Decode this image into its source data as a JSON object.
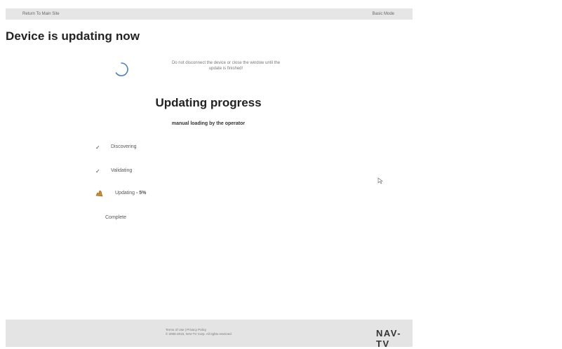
{
  "topbar": {
    "left_link": "Return To Main Site",
    "right_label": "Basic Mode"
  },
  "page": {
    "title": "Device is updating now"
  },
  "notice": {
    "line1": "Do not disconnect the device or close the window until the",
    "line2": "update is finished!"
  },
  "progress": {
    "title": "Updating progress",
    "subtitle": "manual loading by the operator",
    "steps": [
      {
        "label": "Discovering",
        "status": "done",
        "icon": "check-icon"
      },
      {
        "label": "Validating",
        "status": "done",
        "icon": "check-icon"
      },
      {
        "label": "Updating",
        "percent_text": "- 5%",
        "status": "in-progress",
        "icon": "hand-icon"
      },
      {
        "label": "Complete",
        "status": "pending"
      }
    ]
  },
  "footer": {
    "links": "Terms of Use | Privacy Policy",
    "copyright": "© 2006-2015, NAV-TV Corp. All rights reserved",
    "logo": "NAV-TV"
  },
  "colors": {
    "topbar_bg": "#e6e6e6",
    "footer_bg": "#e4e4e4",
    "spinner": "#4a7fc1",
    "progress_icon": "#d08a2a"
  }
}
